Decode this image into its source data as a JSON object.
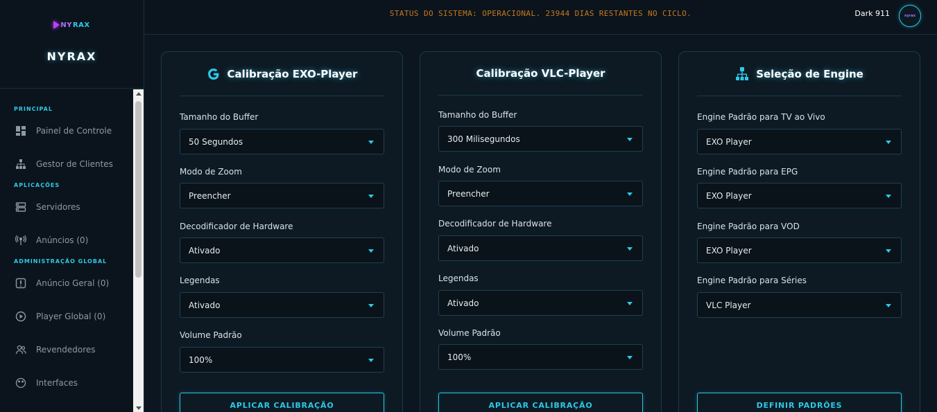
{
  "brand": {
    "logo_part1": "NY",
    "logo_part2": "RAX",
    "name": "NYRAX"
  },
  "topbar": {
    "status": "STATUS DO SISTEMA: OPERACIONAL. 23944 DIAS RESTANTES NO CICLO.",
    "user_name": "Dark 911",
    "avatar_text": "nyrax"
  },
  "sidebar": {
    "sections": [
      {
        "title": "PRINCIPAL",
        "items": [
          {
            "label": "Painel de Controle",
            "icon": "dashboard-icon"
          },
          {
            "label": "Gestor de Clientes",
            "icon": "sitemap-icon"
          }
        ]
      },
      {
        "title": "APLICAÇÕES",
        "items": [
          {
            "label": "Servidores",
            "icon": "server-icon"
          },
          {
            "label": "Anúncios (0)",
            "icon": "broadcast-icon"
          }
        ]
      },
      {
        "title": "ADMINISTRAÇÃO GLOBAL",
        "items": [
          {
            "label": "Anúncio Geral (0)",
            "icon": "alert-icon"
          },
          {
            "label": "Player Global (0)",
            "icon": "play-circle-icon"
          },
          {
            "label": "Revendedores",
            "icon": "users-icon"
          },
          {
            "label": "Interfaces",
            "icon": "palette-icon"
          }
        ]
      }
    ]
  },
  "panels": {
    "exo": {
      "title": "Calibração EXO-Player",
      "icon": "google-icon",
      "fields": [
        {
          "label": "Tamanho do Buffer",
          "value": "50 Segundos"
        },
        {
          "label": "Modo de Zoom",
          "value": "Preencher"
        },
        {
          "label": "Decodificador de Hardware",
          "value": "Ativado"
        },
        {
          "label": "Legendas",
          "value": "Ativado"
        },
        {
          "label": "Volume Padrão",
          "value": "100%"
        }
      ],
      "button": "APLICAR CALIBRAÇÃO"
    },
    "vlc": {
      "title": "Calibração VLC-Player",
      "fields": [
        {
          "label": "Tamanho do Buffer",
          "value": "300 Milisegundos"
        },
        {
          "label": "Modo de Zoom",
          "value": "Preencher"
        },
        {
          "label": "Decodificador de Hardware",
          "value": "Ativado"
        },
        {
          "label": "Legendas",
          "value": "Ativado"
        },
        {
          "label": "Volume Padrão",
          "value": "100%"
        }
      ],
      "button": "APLICAR CALIBRAÇÃO"
    },
    "engine": {
      "title": "Seleção de Engine",
      "icon": "network-icon",
      "fields": [
        {
          "label": "Engine Padrão para TV ao Vivo",
          "value": "EXO Player"
        },
        {
          "label": "Engine Padrão para EPG",
          "value": "EXO Player"
        },
        {
          "label": "Engine Padrão para VOD",
          "value": "EXO Player"
        },
        {
          "label": "Engine Padrão para Séries",
          "value": "VLC Player"
        }
      ],
      "button": "DEFINIR PADRÕES"
    }
  },
  "colors": {
    "accent": "#2ec9e6",
    "status": "#c7781e",
    "background": "#0c1620",
    "panel": "#0d1a24"
  }
}
